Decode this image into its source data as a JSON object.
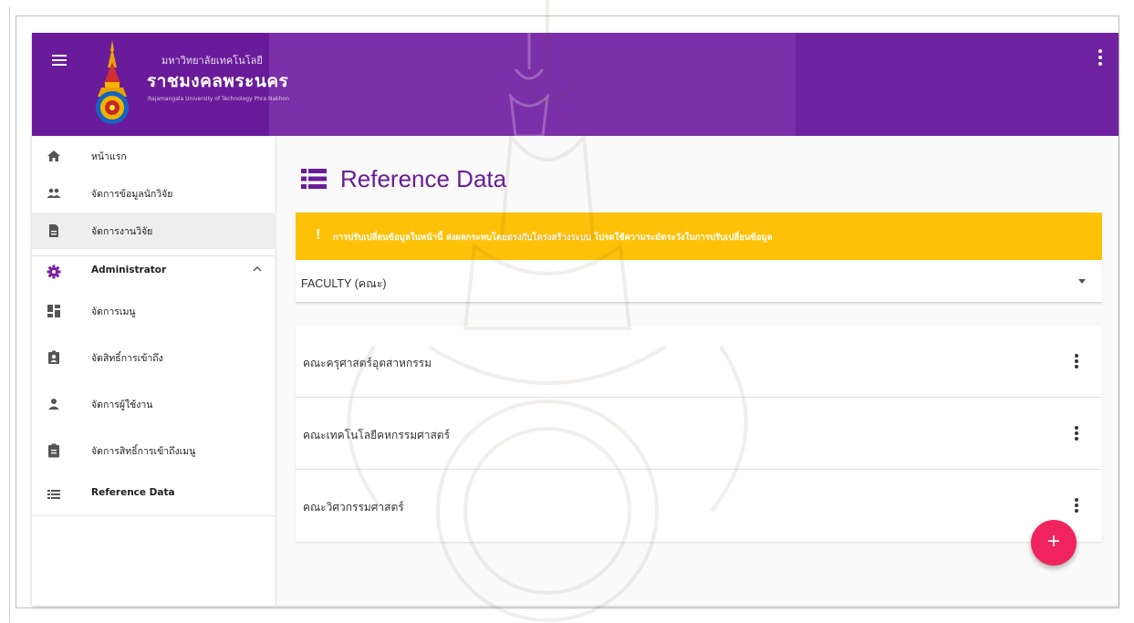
{
  "top_fragment": "ู",
  "header": {
    "uni_name_small": "มหาวิทยาลัยเทคโนโลยี",
    "uni_name_large": "ราชมงคลพระนคร",
    "uni_name_english": "Rajamangala University of Technology Phra Nakhon",
    "menu_icon": "hamburger-icon",
    "more_icon": "more-vert-icon",
    "brand_color": "#6a1b9a"
  },
  "sidebar": {
    "items": [
      {
        "label": "หน้าแรก",
        "icon": "home-icon"
      },
      {
        "label": "จัดการข้อมูลนักวิจัย",
        "icon": "people-icon"
      },
      {
        "label": "จัดการงานวิจัย",
        "icon": "document-icon"
      },
      {
        "label": "Administrator",
        "icon": "gear-icon"
      },
      {
        "label": "จัดการเมนู",
        "icon": "dashboard-icon"
      },
      {
        "label": "จัดสิทธิ์การเข้าถึง",
        "icon": "badge-icon"
      },
      {
        "label": "จัดการผู้ใช้งาน",
        "icon": "person-icon"
      },
      {
        "label": "จัดการสิทธิ์การเข้าถึงเมนู",
        "icon": "clipboard-icon"
      },
      {
        "label": "Reference Data",
        "icon": "list-icon"
      }
    ]
  },
  "main": {
    "title": "Reference Data",
    "warning": {
      "mark": "!",
      "text": "การปรับเปลี่ยนข้อมูลในหน้านี้ ส่งผลกระทบโดยตรงกับโครงสร้างระบบ โปรดใช้ความระมัดระวังในการปรับเปลี่ยนข้อมูล",
      "color": "#fec107"
    },
    "select": {
      "value": "FACULTY (คณะ)"
    },
    "rows": [
      {
        "name": "คณะครุศาสตร์อุตสาหกรรม"
      },
      {
        "name": "คณะเทคโนโลยีคหกรรมศาสตร์"
      },
      {
        "name": "คณะวิศวกรรมศาสตร์"
      }
    ],
    "fab": {
      "label": "+",
      "color": "#f0245c"
    }
  }
}
